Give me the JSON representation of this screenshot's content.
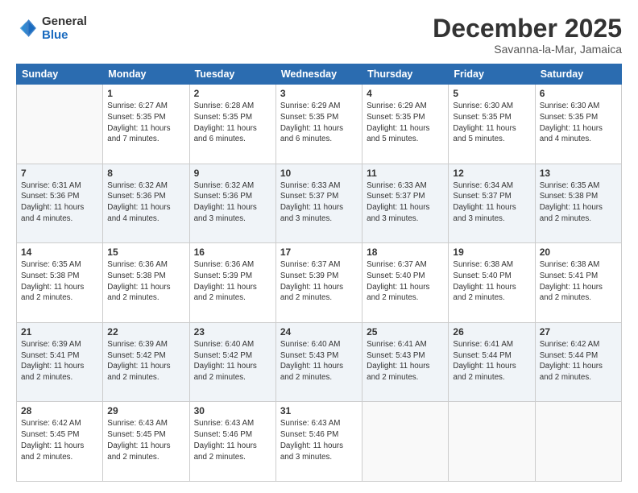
{
  "header": {
    "logo_general": "General",
    "logo_blue": "Blue",
    "month": "December 2025",
    "location": "Savanna-la-Mar, Jamaica"
  },
  "weekdays": [
    "Sunday",
    "Monday",
    "Tuesday",
    "Wednesday",
    "Thursday",
    "Friday",
    "Saturday"
  ],
  "weeks": [
    [
      {
        "day": "",
        "info": ""
      },
      {
        "day": "1",
        "info": "Sunrise: 6:27 AM\nSunset: 5:35 PM\nDaylight: 11 hours\nand 7 minutes."
      },
      {
        "day": "2",
        "info": "Sunrise: 6:28 AM\nSunset: 5:35 PM\nDaylight: 11 hours\nand 6 minutes."
      },
      {
        "day": "3",
        "info": "Sunrise: 6:29 AM\nSunset: 5:35 PM\nDaylight: 11 hours\nand 6 minutes."
      },
      {
        "day": "4",
        "info": "Sunrise: 6:29 AM\nSunset: 5:35 PM\nDaylight: 11 hours\nand 5 minutes."
      },
      {
        "day": "5",
        "info": "Sunrise: 6:30 AM\nSunset: 5:35 PM\nDaylight: 11 hours\nand 5 minutes."
      },
      {
        "day": "6",
        "info": "Sunrise: 6:30 AM\nSunset: 5:35 PM\nDaylight: 11 hours\nand 4 minutes."
      }
    ],
    [
      {
        "day": "7",
        "info": "Sunrise: 6:31 AM\nSunset: 5:36 PM\nDaylight: 11 hours\nand 4 minutes."
      },
      {
        "day": "8",
        "info": "Sunrise: 6:32 AM\nSunset: 5:36 PM\nDaylight: 11 hours\nand 4 minutes."
      },
      {
        "day": "9",
        "info": "Sunrise: 6:32 AM\nSunset: 5:36 PM\nDaylight: 11 hours\nand 3 minutes."
      },
      {
        "day": "10",
        "info": "Sunrise: 6:33 AM\nSunset: 5:37 PM\nDaylight: 11 hours\nand 3 minutes."
      },
      {
        "day": "11",
        "info": "Sunrise: 6:33 AM\nSunset: 5:37 PM\nDaylight: 11 hours\nand 3 minutes."
      },
      {
        "day": "12",
        "info": "Sunrise: 6:34 AM\nSunset: 5:37 PM\nDaylight: 11 hours\nand 3 minutes."
      },
      {
        "day": "13",
        "info": "Sunrise: 6:35 AM\nSunset: 5:38 PM\nDaylight: 11 hours\nand 2 minutes."
      }
    ],
    [
      {
        "day": "14",
        "info": "Sunrise: 6:35 AM\nSunset: 5:38 PM\nDaylight: 11 hours\nand 2 minutes."
      },
      {
        "day": "15",
        "info": "Sunrise: 6:36 AM\nSunset: 5:38 PM\nDaylight: 11 hours\nand 2 minutes."
      },
      {
        "day": "16",
        "info": "Sunrise: 6:36 AM\nSunset: 5:39 PM\nDaylight: 11 hours\nand 2 minutes."
      },
      {
        "day": "17",
        "info": "Sunrise: 6:37 AM\nSunset: 5:39 PM\nDaylight: 11 hours\nand 2 minutes."
      },
      {
        "day": "18",
        "info": "Sunrise: 6:37 AM\nSunset: 5:40 PM\nDaylight: 11 hours\nand 2 minutes."
      },
      {
        "day": "19",
        "info": "Sunrise: 6:38 AM\nSunset: 5:40 PM\nDaylight: 11 hours\nand 2 minutes."
      },
      {
        "day": "20",
        "info": "Sunrise: 6:38 AM\nSunset: 5:41 PM\nDaylight: 11 hours\nand 2 minutes."
      }
    ],
    [
      {
        "day": "21",
        "info": "Sunrise: 6:39 AM\nSunset: 5:41 PM\nDaylight: 11 hours\nand 2 minutes."
      },
      {
        "day": "22",
        "info": "Sunrise: 6:39 AM\nSunset: 5:42 PM\nDaylight: 11 hours\nand 2 minutes."
      },
      {
        "day": "23",
        "info": "Sunrise: 6:40 AM\nSunset: 5:42 PM\nDaylight: 11 hours\nand 2 minutes."
      },
      {
        "day": "24",
        "info": "Sunrise: 6:40 AM\nSunset: 5:43 PM\nDaylight: 11 hours\nand 2 minutes."
      },
      {
        "day": "25",
        "info": "Sunrise: 6:41 AM\nSunset: 5:43 PM\nDaylight: 11 hours\nand 2 minutes."
      },
      {
        "day": "26",
        "info": "Sunrise: 6:41 AM\nSunset: 5:44 PM\nDaylight: 11 hours\nand 2 minutes."
      },
      {
        "day": "27",
        "info": "Sunrise: 6:42 AM\nSunset: 5:44 PM\nDaylight: 11 hours\nand 2 minutes."
      }
    ],
    [
      {
        "day": "28",
        "info": "Sunrise: 6:42 AM\nSunset: 5:45 PM\nDaylight: 11 hours\nand 2 minutes."
      },
      {
        "day": "29",
        "info": "Sunrise: 6:43 AM\nSunset: 5:45 PM\nDaylight: 11 hours\nand 2 minutes."
      },
      {
        "day": "30",
        "info": "Sunrise: 6:43 AM\nSunset: 5:46 PM\nDaylight: 11 hours\nand 2 minutes."
      },
      {
        "day": "31",
        "info": "Sunrise: 6:43 AM\nSunset: 5:46 PM\nDaylight: 11 hours\nand 3 minutes."
      },
      {
        "day": "",
        "info": ""
      },
      {
        "day": "",
        "info": ""
      },
      {
        "day": "",
        "info": ""
      }
    ]
  ]
}
